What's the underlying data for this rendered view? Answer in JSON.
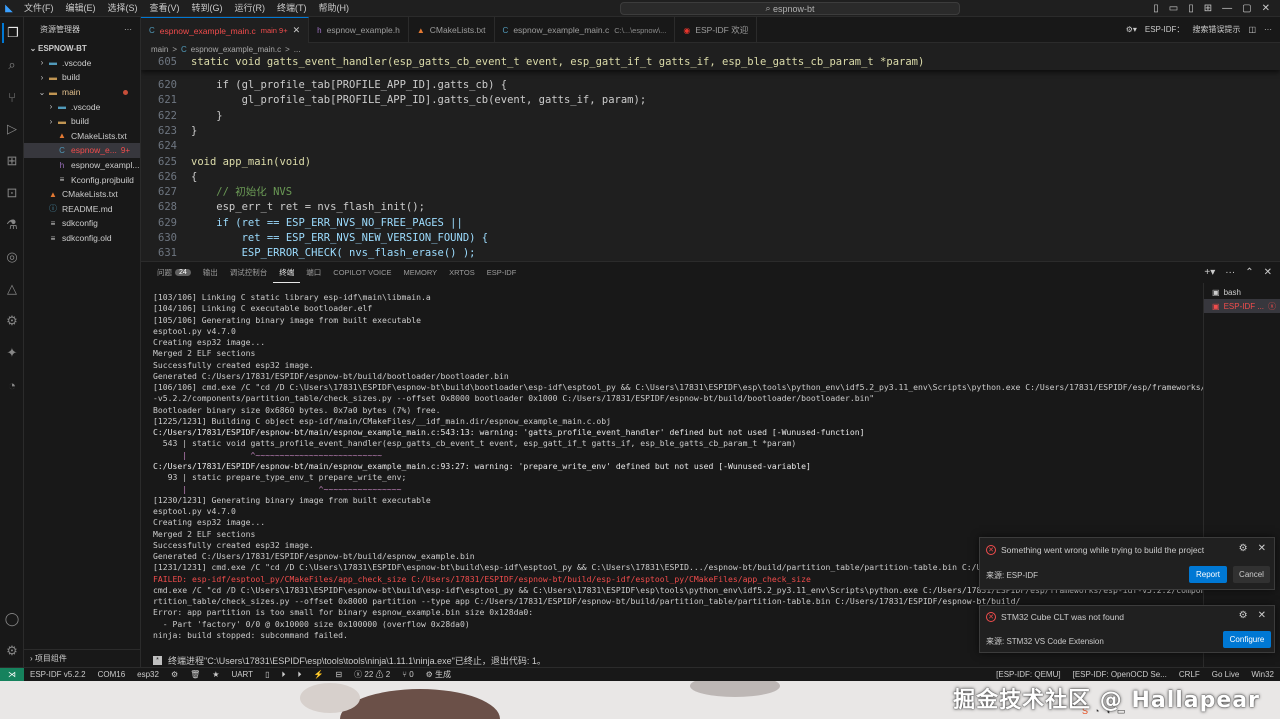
{
  "titlebar": {
    "menu": [
      "文件(F)",
      "编辑(E)",
      "选择(S)",
      "查看(V)",
      "转到(G)",
      "运行(R)",
      "终端(T)",
      "帮助(H)"
    ],
    "search": "espnow-bt"
  },
  "sidebar": {
    "title": "资源管理器",
    "root": "ESPNOW-BT",
    "items": [
      {
        "label": ".vscode",
        "depth": 1,
        "chev": "›",
        "icon": "folder-vscode"
      },
      {
        "label": "build",
        "depth": 1,
        "chev": "›",
        "icon": "folder"
      },
      {
        "label": "main",
        "depth": 1,
        "chev": "⌄",
        "icon": "folder-open",
        "modified": true
      },
      {
        "label": ".vscode",
        "depth": 2,
        "chev": "›",
        "icon": "folder-vscode"
      },
      {
        "label": "build",
        "depth": 2,
        "chev": "›",
        "icon": "folder"
      },
      {
        "label": "CMakeLists.txt",
        "depth": 2,
        "chev": "",
        "icon": "cmake"
      },
      {
        "label": "espnow_e...",
        "depth": 2,
        "chev": "",
        "icon": "c-file",
        "badge": "9+",
        "selected": true
      },
      {
        "label": "espnow_exampl...",
        "depth": 2,
        "chev": "",
        "icon": "h-file"
      },
      {
        "label": "Kconfig.projbuild",
        "depth": 2,
        "chev": "",
        "icon": "file"
      },
      {
        "label": "CMakeLists.txt",
        "depth": 1,
        "chev": "",
        "icon": "cmake"
      },
      {
        "label": "README.md",
        "depth": 1,
        "chev": "",
        "icon": "markdown"
      },
      {
        "label": "sdkconfig",
        "depth": 1,
        "chev": "",
        "icon": "file"
      },
      {
        "label": "sdkconfig.old",
        "depth": 1,
        "chev": "",
        "icon": "file"
      }
    ],
    "outline_label": "项目组件"
  },
  "tabs": [
    {
      "label": "espnow_example_main.c",
      "badge": "main 9+",
      "active": true,
      "icon": "C"
    },
    {
      "label": "espnow_example.h",
      "icon": "h"
    },
    {
      "label": "CMakeLists.txt",
      "icon": "▲"
    },
    {
      "label": "espnow_example_main.c",
      "desc": "C:\\...\\espnow\\...",
      "icon": "C"
    },
    {
      "label": "ESP-IDF 欢迎",
      "icon": "◉"
    }
  ],
  "tab_actions": {
    "esp_idf_label": "ESP-IDF：",
    "search_label": "搜索错误提示"
  },
  "breadcrumb": [
    "main",
    ">",
    "C",
    "espnow_example_main.c",
    ">",
    "..."
  ],
  "editor": {
    "lines": [
      {
        "n": "605",
        "text": "static void gatts_event_handler(esp_gatts_cb_event_t event, esp_gatt_if_t gatts_if, esp_ble_gatts_cb_param_t *param)"
      },
      {
        "n": "620",
        "text": "    if (gl_profile_tab[PROFILE_APP_ID].gatts_cb) {"
      },
      {
        "n": "621",
        "text": "        gl_profile_tab[PROFILE_APP_ID].gatts_cb(event, gatts_if, param);"
      },
      {
        "n": "622",
        "text": "    }"
      },
      {
        "n": "623",
        "text": "}"
      },
      {
        "n": "624",
        "text": ""
      },
      {
        "n": "625",
        "text": "void app_main(void)"
      },
      {
        "n": "626",
        "text": "{"
      },
      {
        "n": "627",
        "text": "    // 初始化 NVS"
      },
      {
        "n": "628",
        "text": "    esp_err_t ret = nvs_flash_init();"
      },
      {
        "n": "629",
        "text": "    if (ret == ESP_ERR_NVS_NO_FREE_PAGES ||"
      },
      {
        "n": "630",
        "text": "        ret == ESP_ERR_NVS_NEW_VERSION_FOUND) {"
      },
      {
        "n": "631",
        "text": "        ESP_ERROR_CHECK( nvs_flash_erase() );"
      }
    ]
  },
  "panel": {
    "tabs": [
      {
        "label": "问题",
        "badge": "24"
      },
      {
        "label": "输出"
      },
      {
        "label": "调试控制台"
      },
      {
        "label": "终端",
        "active": true
      },
      {
        "label": "端口"
      },
      {
        "label": "COPILOT VOICE"
      },
      {
        "label": "MEMORY"
      },
      {
        "label": "XRTOS"
      },
      {
        "label": "ESP-IDF"
      }
    ],
    "terminal_lines": [
      "[103/106] Linking C static library esp-idf\\main\\libmain.a",
      "[104/106] Linking C executable bootloader.elf",
      "[105/106] Generating binary image from built executable",
      "esptool.py v4.7.0",
      "Creating esp32 image...",
      "Merged 2 ELF sections",
      "Successfully created esp32 image.",
      "Generated C:/Users/17831/ESPIDF/espnow-bt/build/bootloader/bootloader.bin",
      "[106/106] cmd.exe /C \"cd /D C:\\Users\\17831\\ESPIDF\\espnow-bt\\build\\bootloader\\esp-idf\\esptool_py && C:\\Users\\17831\\ESPIDF\\esp\\tools\\python_env\\idf5.2_py3.11_env\\Scripts\\python.exe C:/Users/17831/ESPIDF/esp/frameworks/esp-idf-",
      "-v5.2.2/components/partition_table/check_sizes.py --offset 0x8000 bootloader 0x1000 C:/Users/17831/ESPIDF/espnow-bt/build/bootloader/bootloader.bin\"",
      "Bootloader binary size 0x6860 bytes. 0x7a0 bytes (7%) free.",
      "[1225/1231] Building C object esp-idf/main/CMakeFiles/__idf_main.dir/espnow_example_main.c.obj",
      "C:/Users/17831/ESPIDF/espnow-bt/main/espnow_example_main.c:543:13: warning: 'gatts_profile_event_handler' defined but not used [-Wunused-function]",
      "  543 | static void gatts_profile_event_handler(esp_gatts_cb_event_t event, esp_gatt_if_t gatts_if, esp_ble_gatts_cb_param_t *param)",
      "      |             ^~~~~~~~~~~~~~~~~~~~~~~~~~~",
      "C:/Users/17831/ESPIDF/espnow-bt/main/espnow_example_main.c:93:27: warning: 'prepare_write_env' defined but not used [-Wunused-variable]",
      "   93 | static prepare_type_env_t prepare_write_env;",
      "      |                           ^~~~~~~~~~~~~~~~~",
      "[1230/1231] Generating binary image from built executable",
      "esptool.py v4.7.0",
      "Creating esp32 image...",
      "Merged 2 ELF sections",
      "Successfully created esp32 image.",
      "Generated C:/Users/17831/ESPIDF/espnow-bt/build/espnow_example.bin",
      "[1231/1231] cmd.exe /C \"cd /D C:\\Users\\17831\\ESPIDF\\espnow-bt\\build\\esp-idf\\esptool_py && C:\\Users\\17831\\ESPID.../espnow-bt/build/partition_table/partition-table.bin C:/Users/17",
      "FAILED: esp-idf/esptool_py/CMakeFiles/app_check_size C:/Users/17831/ESPIDF/espnow-bt/build/esp-idf/esptool_py/CMakeFiles/app_check_size",
      "cmd.exe /C \"cd /D C:\\Users\\17831\\ESPIDF\\espnow-bt\\build\\esp-idf\\esptool_py && C:\\Users\\17831\\ESPIDF\\esp\\tools\\python_env\\idf5.2_py3.11_env\\Scripts\\python.exe C:/Users/17831/ESPIDF/esp/frameworks/esp-idf-v5.2.2/components/pa",
      "rtition_table/check_sizes.py --offset 0x8000 partition --type app C:/Users/17831/ESPIDF/espnow-bt/build/partition_table/partition-table.bin C:/Users/17831/ESPIDF/espnow-bt/build/",
      "Error: app partition is too small for binary espnow_example.bin size 0x128da0:",
      "  - Part 'factory' 0/0 @ 0x10000 size 0x100000 (overflow 0x28da0)",
      "ninja: build stopped: subcommand failed."
    ],
    "terminal_status": "终端进程\"C:\\Users\\17831\\ESPIDF\\esp\\tools\\tools\\ninja\\1.11.1\\ninja.exe\"已终止，退出代码: 1。",
    "terminals": [
      {
        "label": "bash"
      },
      {
        "label": "ESP-IDF ...",
        "active": true
      }
    ]
  },
  "notifications": [
    {
      "message": "Something went wrong while trying to build the project",
      "source": "来源: ESP-IDF",
      "primary": "Report",
      "secondary": "Cancel"
    },
    {
      "message": "STM32 Cube CLT was not found",
      "source": "来源: STM32 VS Code Extension",
      "primary": "Configure"
    }
  ],
  "statusbar": {
    "items": [
      "ESP-IDF v5.2.2",
      "COM16",
      "esp32",
      "⚙",
      "🗑",
      "★",
      "UART",
      "▯",
      "⏵",
      "⏵",
      "⚡",
      "⊟",
      "ⓧ 22 ⚠ 2",
      "⑂ 0",
      "⚙ 生成"
    ],
    "right_items": [
      "[ESP-IDF: QEMU]",
      "[ESP-IDF: OpenOCD Se...",
      "CRLF",
      "Go Live",
      "Win32"
    ]
  },
  "watermark": "掘金技术社区 @ Hallapear"
}
